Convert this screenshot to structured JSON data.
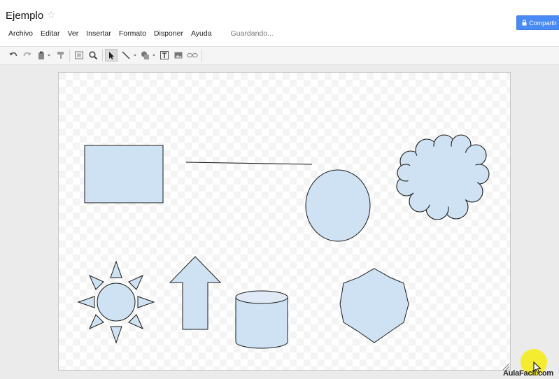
{
  "header": {
    "title": "Ejemplo",
    "star_icon": "star-outline-icon",
    "share_label": "Compartir",
    "share_color": "#4a8af4"
  },
  "menu": {
    "items": [
      "Archivo",
      "Editar",
      "Ver",
      "Insertar",
      "Formato",
      "Disponer",
      "Ayuda"
    ],
    "status": "Guardando..."
  },
  "toolbar": {
    "icons": [
      "undo-icon",
      "redo-icon",
      "paste-icon",
      "paint-format-icon",
      "fit-icon",
      "zoom-icon",
      "select-icon",
      "line-icon",
      "shape-icon",
      "textbox-icon",
      "image-icon",
      "link-icon"
    ]
  },
  "drawing": {
    "fill_color": "#cfe2f3",
    "stroke_color": "#1a1a1a",
    "shapes": [
      "rectangle",
      "line",
      "ellipse",
      "cloud",
      "sun",
      "up-arrow",
      "cylinder",
      "star-burst"
    ]
  },
  "watermark": {
    "logo": "AulaFacil.com"
  }
}
